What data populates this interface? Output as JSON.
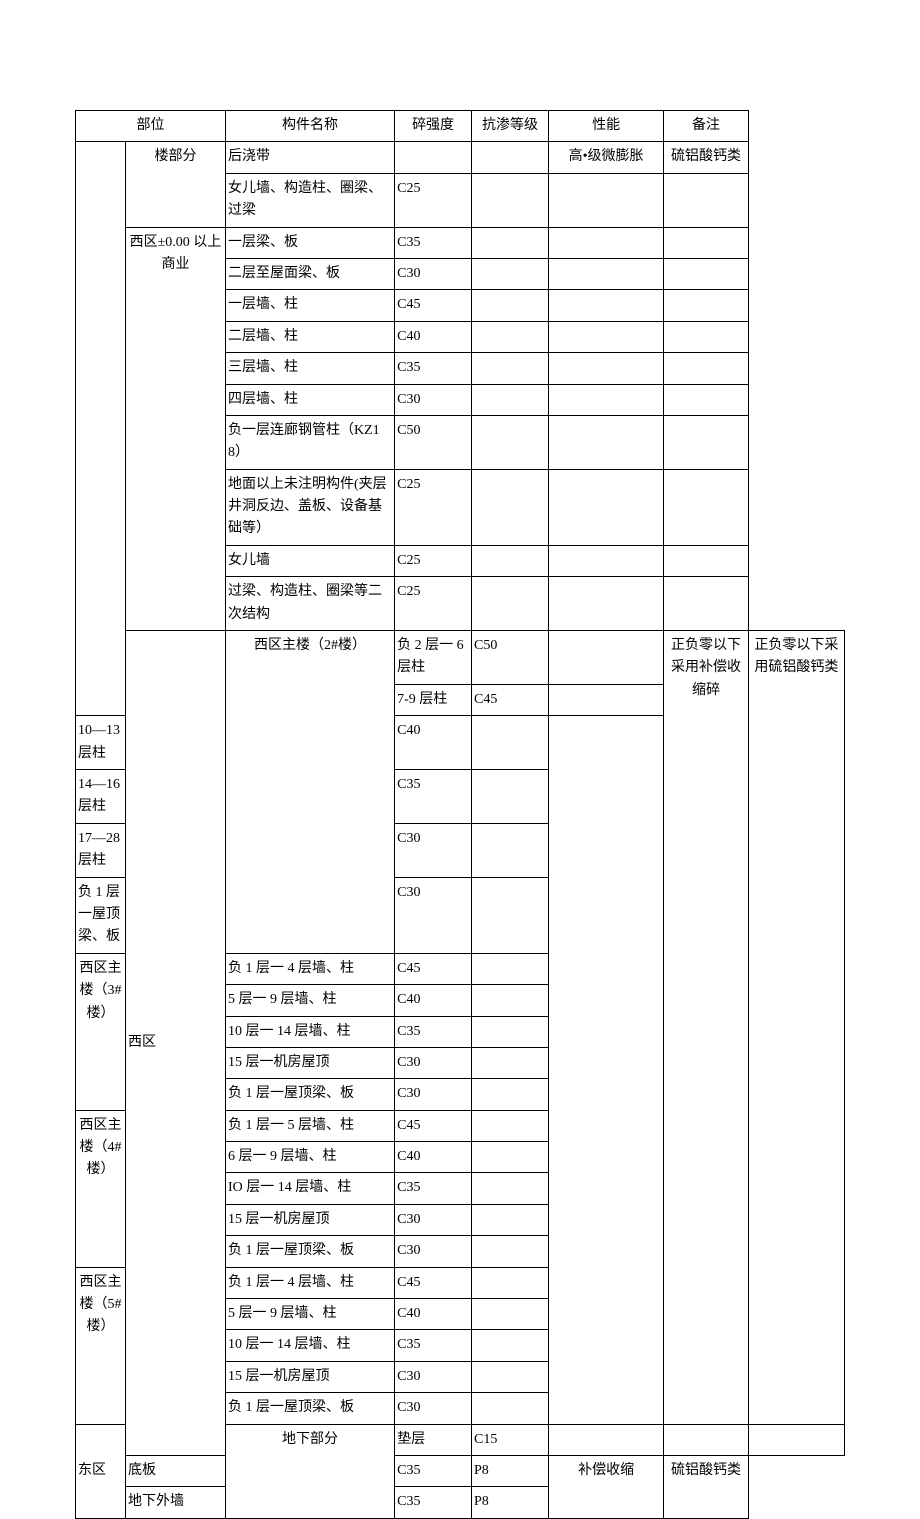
{
  "headers": {
    "zone_section": "部位",
    "component": "构件名称",
    "strength": "碎强度",
    "permeability": "抗渗等级",
    "performance": "性能",
    "note": "备注"
  },
  "rows": [
    {
      "zone": "",
      "section": "楼部分",
      "component": "后浇带",
      "strength": "",
      "perm": "",
      "perf": "高•级微膨胀",
      "note": "硫铝酸钙类",
      "zone_rs": 14,
      "section_rs": 2
    },
    {
      "component": "女儿墙、构造柱、圈梁、过梁",
      "strength": "C25",
      "perm": "",
      "perf": "",
      "note": ""
    },
    {
      "section": "西区±0.00 以上商业",
      "component": "一层梁、板",
      "strength": "C35",
      "perm": "",
      "perf": "",
      "note": "",
      "section_rs": 10
    },
    {
      "component": "二层至屋面梁、板",
      "strength": "C30",
      "perm": "",
      "perf": "",
      "note": ""
    },
    {
      "component": "一层墙、柱",
      "strength": "C45",
      "perm": "",
      "perf": "",
      "note": ""
    },
    {
      "component": "二层墙、柱",
      "strength": "C40",
      "perm": "",
      "perf": "",
      "note": ""
    },
    {
      "component": "三层墙、柱",
      "strength": "C35",
      "perm": "",
      "perf": "",
      "note": ""
    },
    {
      "component": "四层墙、柱",
      "strength": "C30",
      "perm": "",
      "perf": "",
      "note": ""
    },
    {
      "component": "负一层连廊钢管柱（KZ18）",
      "strength": "C50",
      "perm": "",
      "perf": "",
      "note": ""
    },
    {
      "component": "地面以上未注明构件(夹层井洞反边、盖板、设备基础等）",
      "strength": "C25",
      "perm": "",
      "perf": "",
      "note": ""
    },
    {
      "component": "女儿墙",
      "strength": "C25",
      "perm": "",
      "perf": "",
      "note": ""
    },
    {
      "component": "过梁、构造柱、圈梁等二次结构",
      "strength": "C25",
      "perm": "",
      "perf": "",
      "note": ""
    },
    {
      "zone": "西区",
      "section": "西区主楼（2#楼）",
      "component": "负 2 层一 6 层柱",
      "strength": "C50",
      "perm": "",
      "perf": "正负零以下采用补偿收缩碎",
      "note": "正负零以下采用硫铝酸钙类",
      "zone_rs": 22,
      "section_rs": 6,
      "perf_rs": 21,
      "note_rs": 21
    },
    {
      "component": "7-9 层柱",
      "strength": "C45",
      "perm": ""
    },
    {
      "component": "10—13 层柱",
      "strength": "C40",
      "perm": ""
    },
    {
      "component": "14—16 层柱",
      "strength": "C35",
      "perm": ""
    },
    {
      "component": "17—28 层柱",
      "strength": "C30",
      "perm": ""
    },
    {
      "component": "负 1 层一屋顶梁、板",
      "strength": "C30",
      "perm": ""
    },
    {
      "section": "西区主楼（3#楼）",
      "component": "负 1 层一 4 层墙、柱",
      "strength": "C45",
      "perm": "",
      "section_rs": 5
    },
    {
      "component": "5 层一 9 层墙、柱",
      "strength": "C40",
      "perm": ""
    },
    {
      "component": "10 层一 14 层墙、柱",
      "strength": "C35",
      "perm": ""
    },
    {
      "component": "15 层一机房屋顶",
      "strength": "C30",
      "perm": ""
    },
    {
      "component": "负 1 层一屋顶梁、板",
      "strength": "C30",
      "perm": ""
    },
    {
      "section": "西区主楼（4#楼）",
      "component": "负 1 层一 5 层墙、柱",
      "strength": "C45",
      "perm": "",
      "section_rs": 5
    },
    {
      "component": "6 层一 9 层墙、柱",
      "strength": "C40",
      "perm": ""
    },
    {
      "component": "IO 层一 14 层墙、柱",
      "strength": "C35",
      "perm": ""
    },
    {
      "component": "15 层一机房屋顶",
      "strength": "C30",
      "perm": ""
    },
    {
      "component": "负 1 层一屋顶梁、板",
      "strength": "C30",
      "perm": ""
    },
    {
      "section": "西区主楼（5#楼）",
      "component": "负 1 层一 4 层墙、柱",
      "strength": "C45",
      "perm": "",
      "section_rs": 5
    },
    {
      "component": "5 层一 9 层墙、柱",
      "strength": "C40",
      "perm": ""
    },
    {
      "component": "10 层一 14 层墙、柱",
      "strength": "C35",
      "perm": ""
    },
    {
      "component": "15 层一机房屋顶",
      "strength": "C30",
      "perm": ""
    },
    {
      "component": "负 1 层一屋顶梁、板",
      "strength": "C30",
      "perm": ""
    },
    {
      "zone": "东区",
      "section": "地下部分",
      "component": "垫层",
      "strength": "C15",
      "perm": "",
      "perf": "",
      "note": "",
      "zone_rs": 3,
      "section_rs": 3
    },
    {
      "component": "底板",
      "strength": "C35",
      "perm": "P8",
      "perf": "补偿收缩",
      "note": "硫铝酸钙类",
      "perf_rs": 2,
      "note_rs": 2
    },
    {
      "component": "地下外墙",
      "strength": "C35",
      "perm": "P8"
    }
  ]
}
